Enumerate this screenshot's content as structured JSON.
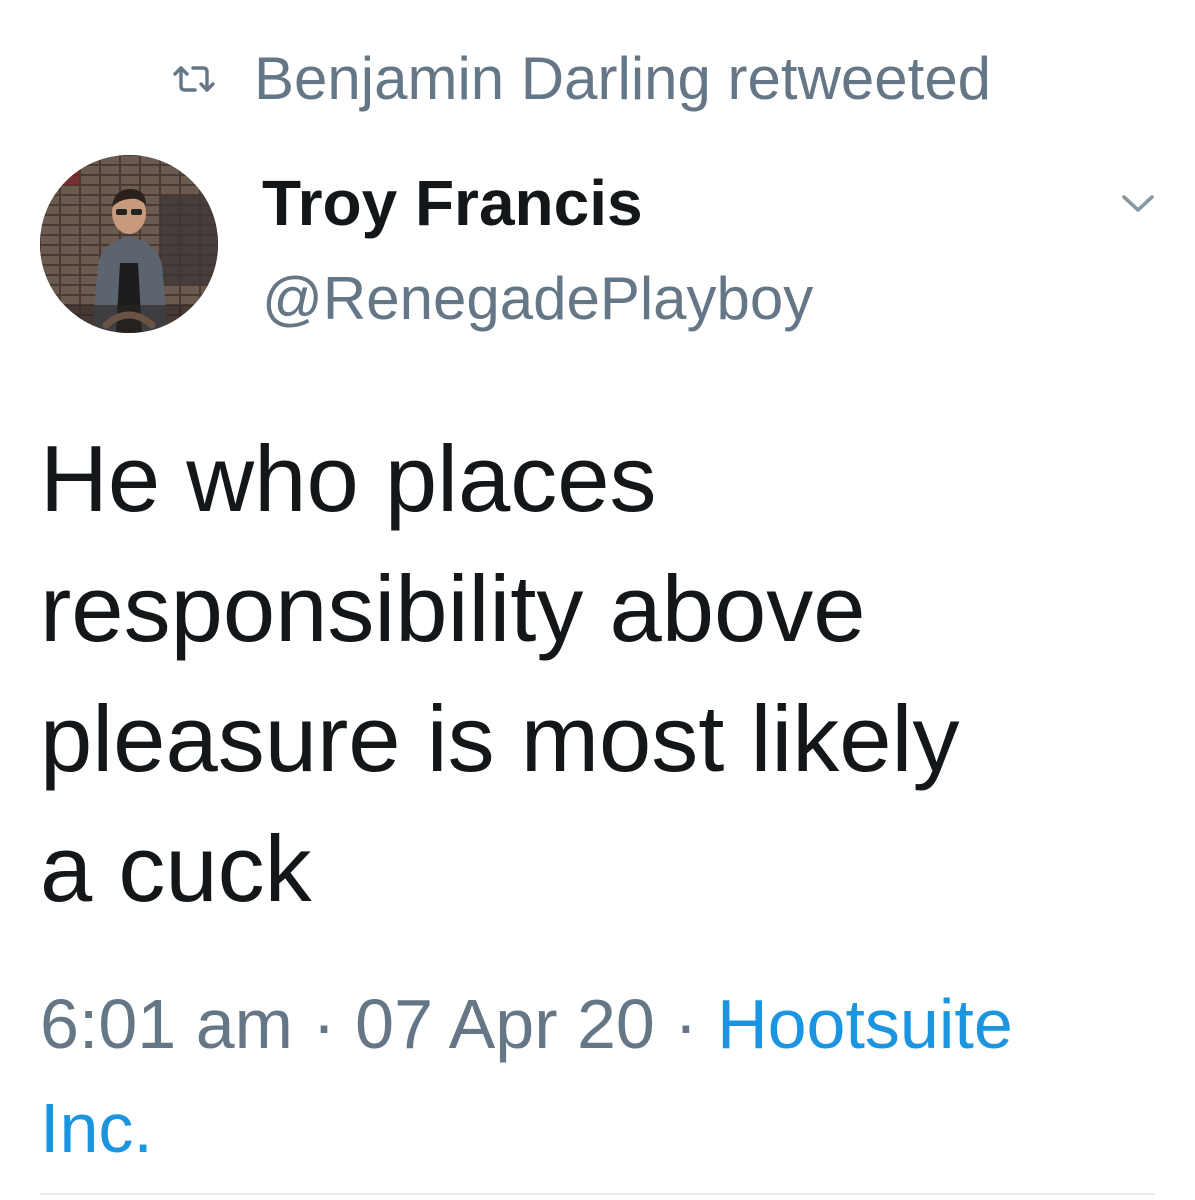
{
  "retweet_banner": {
    "icon": "retweet-icon",
    "text": "Benjamin Darling retweeted"
  },
  "author": {
    "display_name": "Troy Francis",
    "handle": "@RenegadePlayboy",
    "avatar": "profile-photo"
  },
  "menu": {
    "icon": "chevron-down-icon"
  },
  "tweet": {
    "lines": [
      "He who places",
      "responsibility above",
      "pleasure is most likely",
      "a cuck"
    ]
  },
  "meta": {
    "time": "6:01 am",
    "separator": "·",
    "date": "07 Apr 20",
    "source_line1": "Hootsuite",
    "source_line2": "Inc."
  },
  "colors": {
    "text_primary": "#14171a",
    "text_secondary": "#657786",
    "link": "#1b95e0",
    "divider": "#e6ecf0"
  }
}
